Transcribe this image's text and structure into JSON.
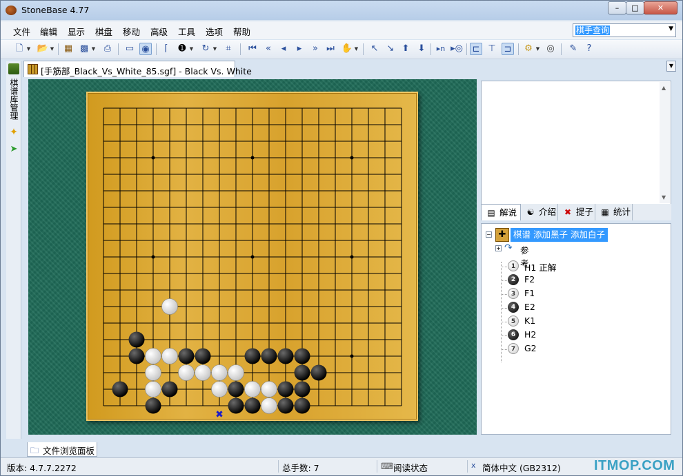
{
  "window": {
    "title": "StoneBase 4.77",
    "controls": {
      "minimize": "–",
      "maximize": "□",
      "close": "✕"
    }
  },
  "menu": [
    "文件",
    "编辑",
    "显示",
    "棋盘",
    "移动",
    "高级",
    "工具",
    "选项",
    "帮助"
  ],
  "search": {
    "value": "棋手查询",
    "arrow": "▼"
  },
  "toolbar_icons": [
    "new-file-icon",
    "open-file-icon",
    "board-edit-icon",
    "copy-board-icon",
    "print-icon",
    "board-view-icon",
    "sound-icon",
    "coordinates-icon",
    "move-number-icon",
    "rotate-icon",
    "crop-icon",
    "first-move-icon",
    "back-many-icon",
    "back-icon",
    "forward-icon",
    "forward-many-icon",
    "last-move-icon",
    "auto-play-icon",
    "prev-variation-icon",
    "next-variation-icon",
    "up-variation-icon",
    "down-variation-icon",
    "goto-move-icon",
    "navigate-icon",
    "tree-view-icon",
    "tree-branch-icon",
    "tree-list-icon",
    "tools-icon",
    "zoom-icon",
    "settings-icon",
    "help-icon"
  ],
  "left_panel": {
    "label": "棋谱库管理"
  },
  "document_tab": {
    "title": "[手筋部_Black_Vs_White_85.sgf] - Black Vs. White"
  },
  "board": {
    "size": 19,
    "star_points": [
      [
        3,
        3
      ],
      [
        9,
        3
      ],
      [
        15,
        3
      ],
      [
        3,
        9
      ],
      [
        9,
        9
      ],
      [
        15,
        9
      ],
      [
        3,
        15
      ],
      [
        9,
        15
      ],
      [
        15,
        15
      ]
    ],
    "black_stones": [
      [
        2,
        14
      ],
      [
        2,
        15
      ],
      [
        4,
        15
      ],
      [
        5,
        15
      ],
      [
        6,
        15
      ],
      [
        9,
        15
      ],
      [
        10,
        15
      ],
      [
        11,
        15
      ],
      [
        12,
        15
      ],
      [
        12,
        16
      ],
      [
        13,
        16
      ],
      [
        12,
        17
      ],
      [
        11,
        17
      ],
      [
        10,
        17
      ],
      [
        9,
        17
      ],
      [
        8,
        17
      ],
      [
        4,
        17
      ],
      [
        3,
        17
      ],
      [
        1,
        17
      ],
      [
        3,
        18
      ],
      [
        8,
        18
      ],
      [
        9,
        18
      ],
      [
        11,
        18
      ],
      [
        12,
        18
      ]
    ],
    "white_stones": [
      [
        4,
        12
      ],
      [
        3,
        15
      ],
      [
        4,
        15
      ],
      [
        3,
        16
      ],
      [
        5,
        16
      ],
      [
        6,
        16
      ],
      [
        7,
        16
      ],
      [
        8,
        16
      ],
      [
        3,
        17
      ],
      [
        7,
        17
      ],
      [
        9,
        17
      ],
      [
        10,
        17
      ],
      [
        10,
        18
      ]
    ],
    "last_move_marker": [
      7,
      19
    ]
  },
  "info_tabs": [
    {
      "label": "解说",
      "icon": "comment-icon"
    },
    {
      "label": "介绍",
      "icon": "intro-icon"
    },
    {
      "label": "提子",
      "icon": "capture-icon"
    },
    {
      "label": "统计",
      "icon": "stats-icon"
    }
  ],
  "tree": {
    "root": {
      "expand": "−",
      "label": "棋谱  添加黑子 添加白子"
    },
    "reference": {
      "expand": "+",
      "label": "参考"
    },
    "moves": [
      {
        "num": "1",
        "color": "white",
        "label": "H1 正解"
      },
      {
        "num": "2",
        "color": "black",
        "label": "F2"
      },
      {
        "num": "3",
        "color": "white",
        "label": "F1"
      },
      {
        "num": "4",
        "color": "black",
        "label": "E2"
      },
      {
        "num": "5",
        "color": "white",
        "label": "K1"
      },
      {
        "num": "6",
        "color": "black",
        "label": "H2"
      },
      {
        "num": "7",
        "color": "white",
        "label": "G2"
      }
    ]
  },
  "bottom_tab": {
    "label": "文件浏览面板"
  },
  "status": {
    "version": "版本: 4.7.7.2272",
    "total_moves": "总手数: 7",
    "mode": "阅读状态",
    "encoding": "简体中文 (GB2312)"
  },
  "watermark": "ITMOP.COM"
}
